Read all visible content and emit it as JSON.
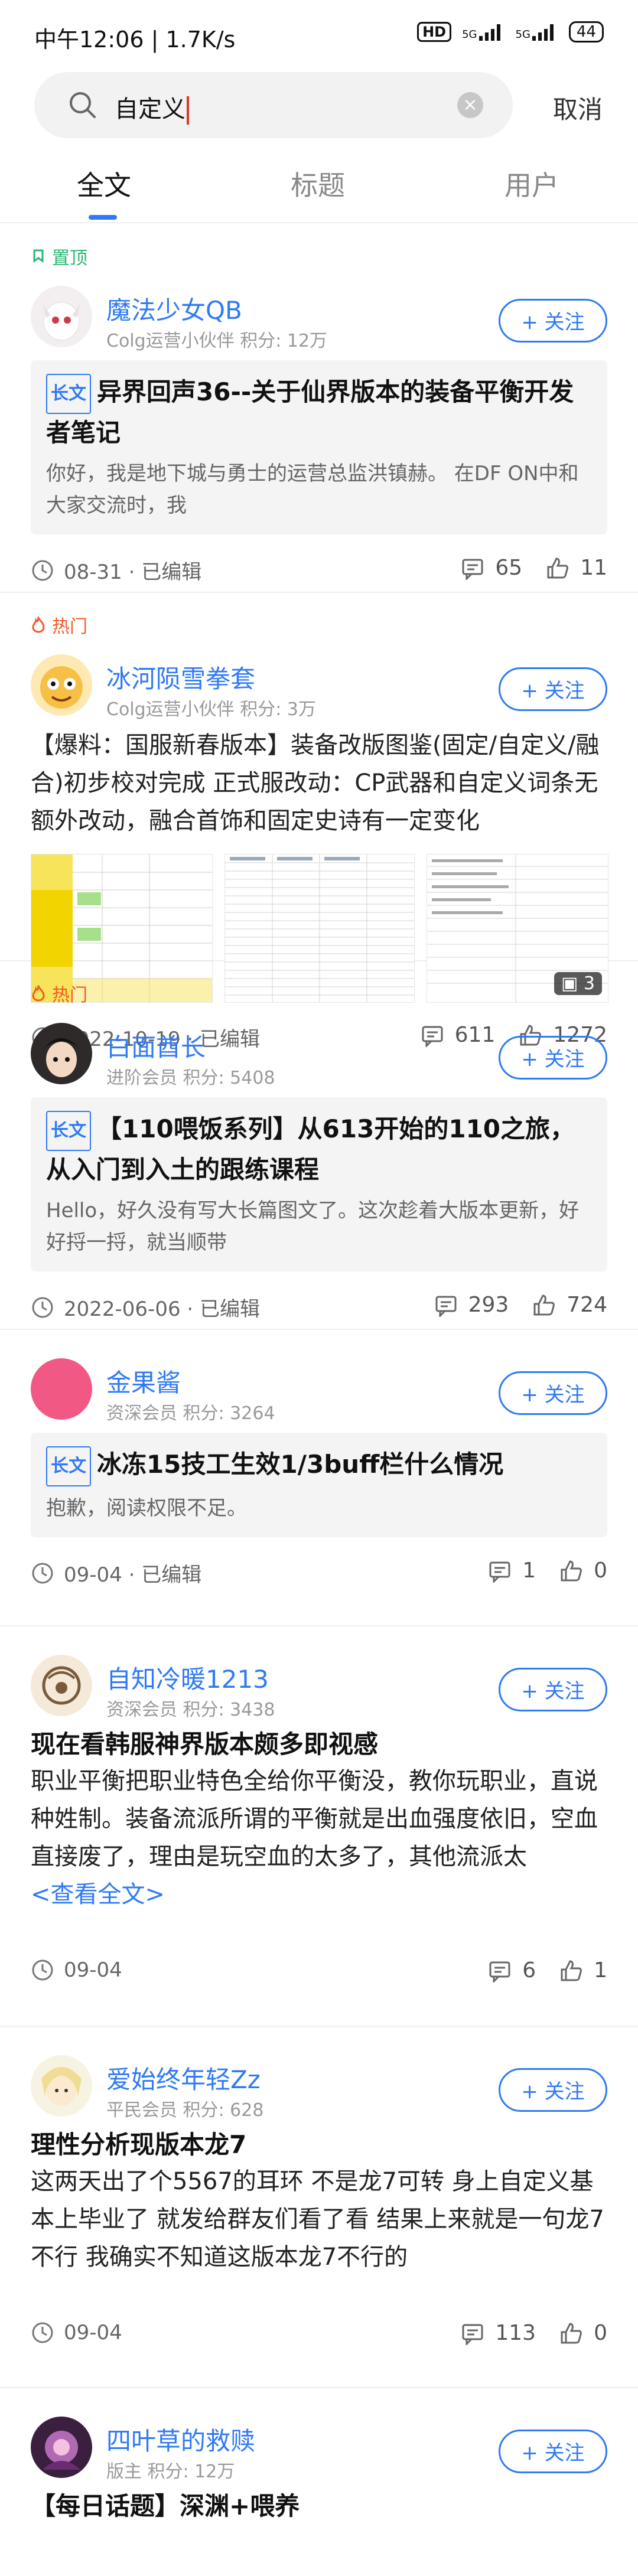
{
  "status_bar": {
    "time_speed": "中午12:06 | 1.7K/s",
    "hd": "HD",
    "net1": "5G",
    "net2": "5G",
    "battery": "44"
  },
  "search": {
    "query": "自定义",
    "cancel_label": "取消"
  },
  "tabs": [
    {
      "label": "全文",
      "active": true
    },
    {
      "label": "标题",
      "active": false
    },
    {
      "label": "用户",
      "active": false
    }
  ],
  "posts": [
    {
      "label": "置顶",
      "author": "魔法少女QB",
      "meta": "Colg运营小伙伴  积分: 12万",
      "follow": "+ 关注",
      "badge": "长文",
      "title": "异界回声36--关于仙界版本的装备平衡开发者笔记",
      "excerpt": "你好，我是地下城与勇士的运营总监洪镇赫。 在DF ON中和大家交流时，我",
      "time": "08-31 · 已编辑",
      "comments": "65",
      "likes": "11"
    },
    {
      "label": "热门",
      "author": "冰河陨雪拳套",
      "meta": "Colg运营小伙伴  积分: 3万",
      "follow": "+ 关注",
      "body": "【爆料：国服新春版本】装备改版图鉴(固定/自定义/融合)初步校对完成       正式服改动：CP武器和自定义词条无额外改动，融合首饰和固定史诗有一定变化",
      "image_count": "3",
      "time": "2022-10-19 · 已编辑",
      "comments": "611",
      "likes": "1272"
    },
    {
      "label": "热门",
      "author": "白面酋长",
      "meta": "进阶会员  积分: 5408",
      "follow": "+ 关注",
      "badge": "长文",
      "title": "【110喂饭系列】从613开始的110之旅，从入门到入土的跟练课程",
      "excerpt": "Hello，好久没有写大长篇图文了。这次趁着大版本更新，好好捋一捋，就当顺带",
      "time": "2022-06-06 · 已编辑",
      "comments": "293",
      "likes": "724"
    },
    {
      "author": "金果酱",
      "meta": "资深会员  积分: 3264",
      "follow": "+ 关注",
      "badge": "长文",
      "title": "冰冻15技工生效1/3buff栏什么情况",
      "excerpt": "抱歉，阅读权限不足。",
      "time": "09-04 · 已编辑",
      "comments": "1",
      "likes": "0"
    },
    {
      "author": "自知冷暖1213",
      "meta": "资深会员  积分: 3438",
      "follow": "+ 关注",
      "title": "现在看韩服神界版本颇多即视感",
      "body": "职业平衡把职业特色全给你平衡没，教你玩职业，直说种姓制。装备流派所谓的平衡就是出血强度依旧，空血直接废了，理由是玩空血的太多了，其他流派太",
      "read_more": "<查看全文>",
      "time": "09-04",
      "comments": "6",
      "likes": "1"
    },
    {
      "author": "爱始终年轻Zz",
      "meta": "平民会员  积分: 628",
      "follow": "+ 关注",
      "title": "理性分析现版本龙7",
      "body": "这两天出了个5567的耳环 不是龙7可转 身上自定义基本上毕业了 就发给群友们看了看 结果上来就是一句龙7不行 我确实不知道这版本龙7不行的",
      "time": "09-04",
      "comments": "113",
      "likes": "0"
    },
    {
      "author": "四叶草的救赎",
      "meta": "版主  积分: 12万",
      "follow": "+ 关注",
      "title": "【每日话题】深渊+喂养"
    }
  ]
}
